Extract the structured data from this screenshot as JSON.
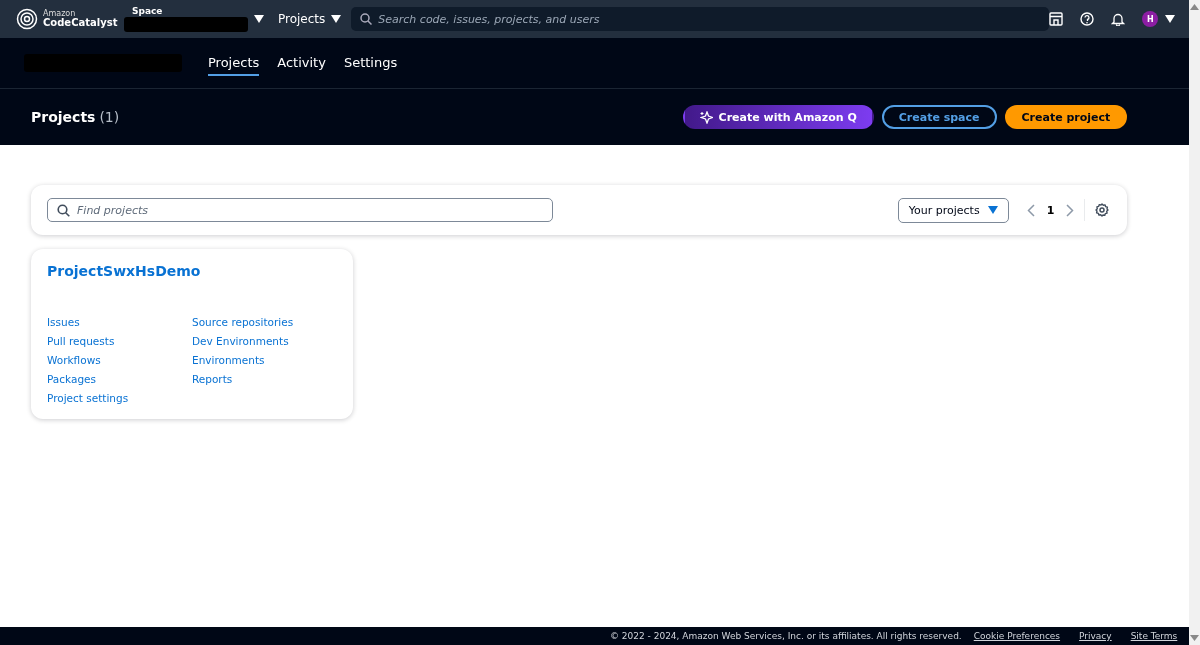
{
  "top_bar": {
    "logo": {
      "line1": "Amazon",
      "line2": "CodeCatalyst"
    },
    "space_label": "Space",
    "projects_menu": "Projects",
    "search": {
      "placeholder": "Search code, issues, projects, and users"
    },
    "avatar": "H"
  },
  "tabs": [
    {
      "label": "Projects",
      "selected": true
    },
    {
      "label": "Activity",
      "selected": false
    },
    {
      "label": "Settings",
      "selected": false
    }
  ],
  "header": {
    "title": "Projects",
    "count": "(1)",
    "buttons": [
      {
        "label": "Create with Amazon Q",
        "kind": "ai"
      },
      {
        "label": "Create space",
        "kind": "outline"
      },
      {
        "label": "Create project",
        "kind": "primary"
      }
    ]
  },
  "filter": {
    "search": {
      "placeholder": "Find projects"
    },
    "dropdown": "Your projects",
    "page": "1"
  },
  "projects": [
    {
      "name": "ProjectSwxHsDemo",
      "links_left": [
        "Issues",
        "Pull requests",
        "Workflows",
        "Packages",
        "Project settings"
      ],
      "links_right": [
        "Source repositories",
        "Dev Environments",
        "Environments",
        "Reports"
      ]
    }
  ],
  "footer": {
    "copyright": "© 2022 - 2024, Amazon Web Services, Inc. or its affiliates. All rights reserved.",
    "links": [
      "Cookie Preferences",
      "Privacy",
      "Site Terms"
    ]
  }
}
